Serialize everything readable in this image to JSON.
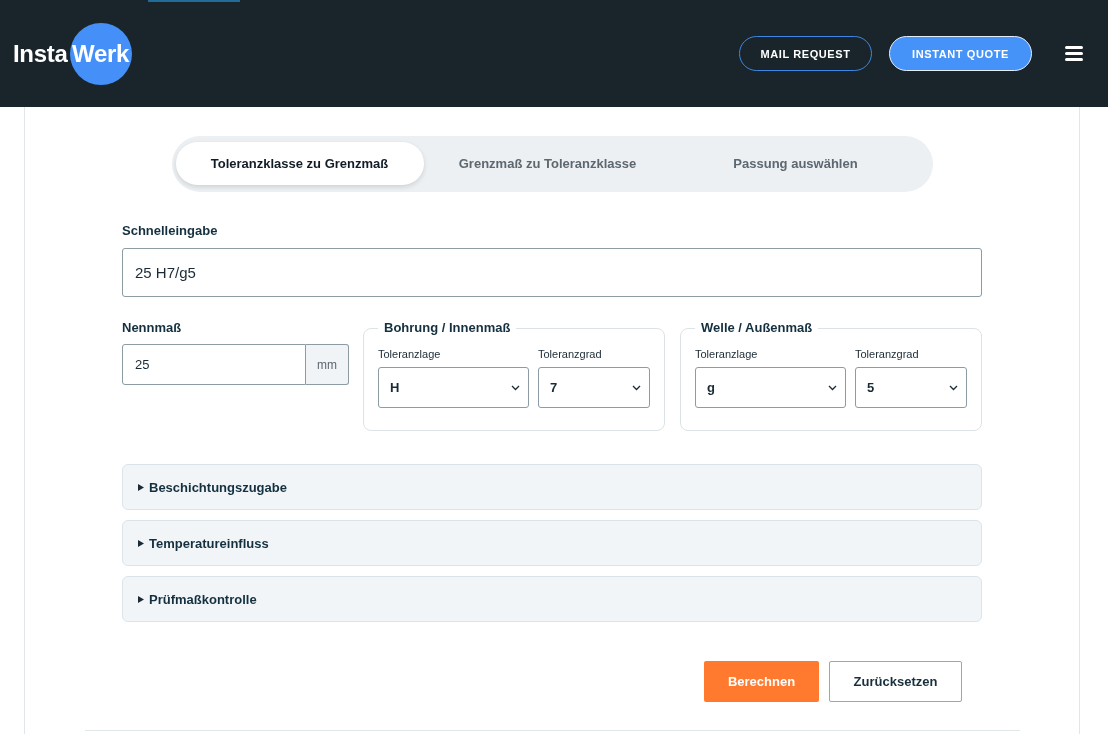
{
  "header": {
    "logo": {
      "text": "Insta",
      "highlight": "Werk"
    },
    "buttons": [
      {
        "label": "MAIL REQUEST",
        "kind": "outline"
      },
      {
        "label": "INSTANT QUOTE",
        "kind": "filled"
      }
    ]
  },
  "tabs": [
    {
      "label": "Toleranzklasse zu Grenzmaß",
      "selected": true
    },
    {
      "label": "Grenzmaß zu Toleranzklasse",
      "selected": false
    },
    {
      "label": "Passung auswählen",
      "selected": false
    }
  ],
  "quick_entry": {
    "label": "Schnelleingabe",
    "value": "25 H7/g5"
  },
  "nominal_size": {
    "label": "Nennmaß",
    "value": "25",
    "unit": "mm"
  },
  "groups": [
    {
      "title": "Bohrung / Innenmaß",
      "fields": [
        {
          "label": "Toleranzlage",
          "value": "H"
        },
        {
          "label": "Toleranzgrad",
          "value": "7"
        }
      ]
    },
    {
      "title": "Welle / Außenmaß",
      "fields": [
        {
          "label": "Toleranzlage",
          "value": "g"
        },
        {
          "label": "Toleranzgrad",
          "value": "5"
        }
      ]
    }
  ],
  "sections": [
    {
      "label": "Beschichtungszugabe",
      "expanded": false
    },
    {
      "label": "Temperatureinfluss",
      "expanded": false
    },
    {
      "label": "Prüfmaßkontrolle",
      "expanded": false
    }
  ],
  "actions": [
    {
      "label": "Berechnen",
      "kind": "primary"
    },
    {
      "label": "Zurücksetzen",
      "kind": "secondary"
    }
  ]
}
